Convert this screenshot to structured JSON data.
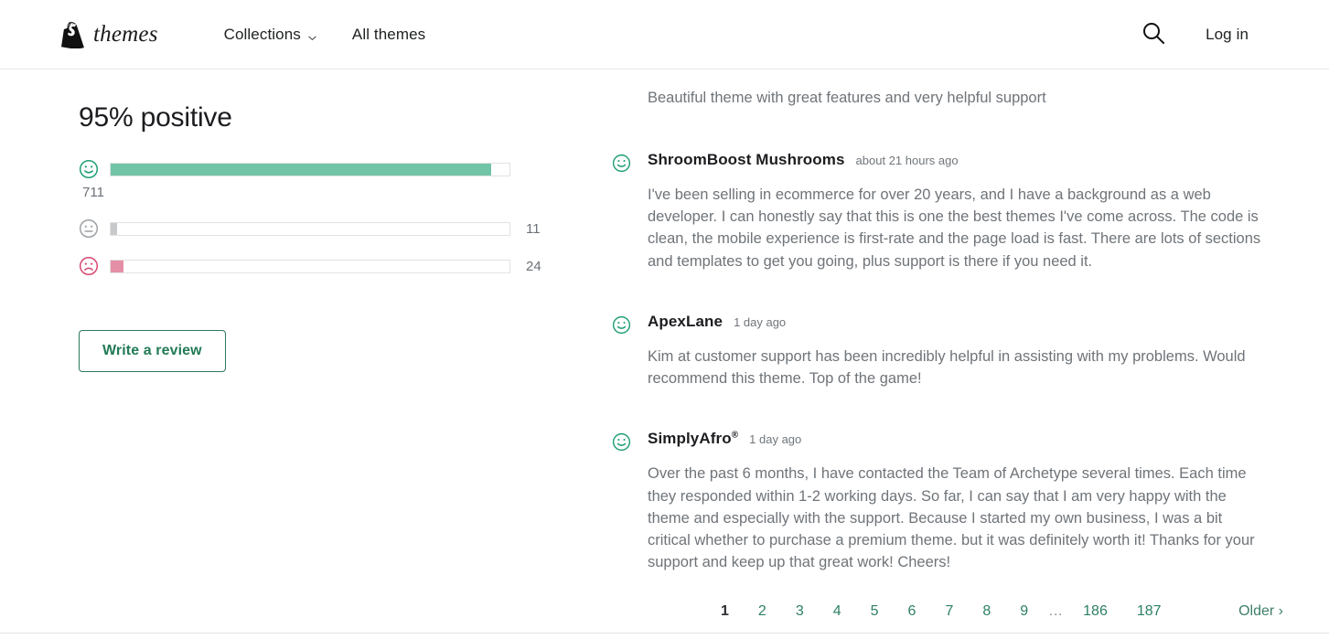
{
  "header": {
    "brand_icon": "shopify-bag-logo",
    "brand_word": "themes",
    "nav": [
      {
        "label": "Collections",
        "has_chevron": true,
        "icon": "chevron-down-icon"
      },
      {
        "label": "All themes",
        "has_chevron": false
      }
    ],
    "search_icon": "search-icon",
    "login_label": "Log in"
  },
  "summary": {
    "title": "95% positive",
    "rows": [
      {
        "icon": "smiley-happy-icon",
        "sentiment": "positive",
        "count": "711",
        "percent": 95.4,
        "count_below": true
      },
      {
        "icon": "smiley-neutral-icon",
        "sentiment": "neutral",
        "count": "11",
        "percent": 1.5,
        "count_below": false
      },
      {
        "icon": "smiley-sad-icon",
        "sentiment": "negative",
        "count": "24",
        "percent": 3.2,
        "count_below": false
      }
    ],
    "write_review_label": "Write a review"
  },
  "reviews": {
    "teaser_text": "Beautiful theme with great features and very helpful support",
    "items": [
      {
        "icon": "smiley-happy-icon",
        "author": "ShroomBoost Mushrooms",
        "author_suffix": "",
        "time": "about 21 hours ago",
        "text": "I've been selling in ecommerce for over 20 years, and I have a background as a web developer. I can honestly say that this is one the best themes I've come across. The code is clean, the mobile experience is first-rate and the page load is fast. There are lots of sections and templates to get you going, plus support is there if you need it."
      },
      {
        "icon": "smiley-happy-icon",
        "author": "ApexLane",
        "author_suffix": "",
        "time": "1 day ago",
        "text": "Kim at customer support has been incredibly helpful in assisting with my problems. Would recommend this theme. Top of the game!"
      },
      {
        "icon": "smiley-happy-icon",
        "author": "SimplyAfro",
        "author_suffix": "®",
        "time": "1 day ago",
        "text": "Over the past 6 months, I have contacted the Team of Archetype several times. Each time they responded within 1-2 working days. So far, I can say that I am very happy with the theme and especially with the support. Because I started my own business, I was a bit critical whether to purchase a premium theme. but it was definitely worth it! Thanks for your support and keep up that great work! Cheers!"
      }
    ]
  },
  "pagination": {
    "pages": [
      "1",
      "2",
      "3",
      "4",
      "5",
      "6",
      "7",
      "8",
      "9"
    ],
    "ellipsis": "…",
    "tail_pages": [
      "186",
      "187"
    ],
    "current_page": "1",
    "older_label": "Older ›"
  },
  "colors": {
    "positive_bar": "#71c4a5",
    "neutral_bar": "#c8c9cb",
    "negative_bar": "#e58fa6",
    "accent_green": "#2d8062",
    "text_muted": "#6f7479"
  }
}
